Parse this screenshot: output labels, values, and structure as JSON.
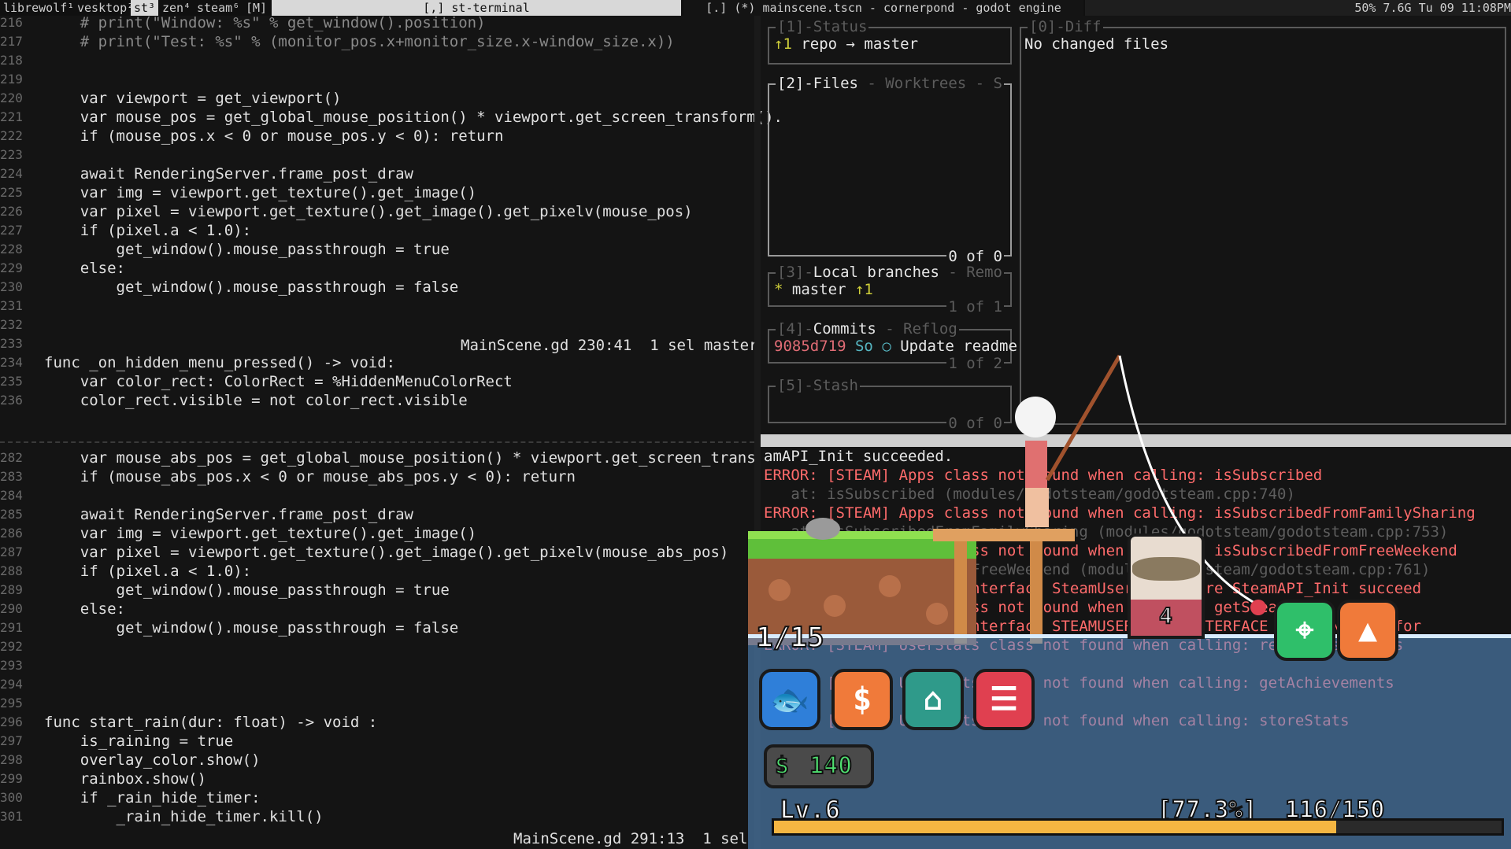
{
  "topbar": {
    "workspaces": [
      "librewolf¹",
      "vesktop²",
      "st³",
      "zen⁴",
      "steam⁶",
      "[M]"
    ],
    "active_workspace": "st³",
    "left_title": "[,] st-terminal",
    "right_title": "[.] (*) mainscene.tscn - cornerpond - godot engine",
    "system": "50% 7.6G Tu 09 11:08PM"
  },
  "editor_top": {
    "lines": [
      {
        "n": "216",
        "t": "    # print(\"Window: %s\" % get_window().position)",
        "c": true
      },
      {
        "n": "217",
        "t": "    # print(\"Test: %s\" % (monitor_pos.x+monitor_size.x-window_size.x))",
        "c": true
      },
      {
        "n": "218",
        "t": ""
      },
      {
        "n": "219",
        "t": ""
      },
      {
        "n": "220",
        "t": "    var viewport = get_viewport()"
      },
      {
        "n": "221",
        "t": "    var mouse_pos = get_global_mouse_position() * viewport.get_screen_transform()."
      },
      {
        "n": "222",
        "t": "    if (mouse_pos.x < 0 or mouse_pos.y < 0): return"
      },
      {
        "n": "223",
        "t": ""
      },
      {
        "n": "224",
        "t": "    await RenderingServer.frame_post_draw"
      },
      {
        "n": "225",
        "t": "    var img = viewport.get_texture().get_image()"
      },
      {
        "n": "226",
        "t": "    var pixel = viewport.get_texture().get_image().get_pixelv(mouse_pos)"
      },
      {
        "n": "227",
        "t": "    if (pixel.a < 1.0):"
      },
      {
        "n": "228",
        "t": "        get_window().mouse_passthrough = true"
      },
      {
        "n": "229",
        "t": "    else:"
      },
      {
        "n": "230",
        "t": "        get_window().mouse_passthrough = false"
      },
      {
        "n": "231",
        "t": ""
      },
      {
        "n": "232",
        "t": ""
      },
      {
        "n": "233",
        "t": ""
      },
      {
        "n": "234",
        "t": "func _on_hidden_menu_pressed() -> void:"
      },
      {
        "n": "235",
        "t": "    var color_rect: ColorRect = %HiddenMenuColorRect"
      },
      {
        "n": "236",
        "t": "    color_rect.visible = not color_rect.visible"
      }
    ],
    "status": "MainScene.gd 230:41  1 sel master"
  },
  "editor_bottom": {
    "lines": [
      {
        "n": "282",
        "t": "    var mouse_abs_pos = get_global_mouse_position() * viewport.get_screen_transfor"
      },
      {
        "n": "283",
        "t": "    if (mouse_abs_pos.x < 0 or mouse_abs_pos.y < 0): return"
      },
      {
        "n": "284",
        "t": ""
      },
      {
        "n": "285",
        "t": "    await RenderingServer.frame_post_draw"
      },
      {
        "n": "286",
        "t": "    var img = viewport.get_texture().get_image()"
      },
      {
        "n": "287",
        "t": "    var pixel = viewport.get_texture().get_image().get_pixelv(mouse_abs_pos)"
      },
      {
        "n": "288",
        "t": "    if (pixel.a < 1.0):"
      },
      {
        "n": "289",
        "t": "        get_window().mouse_passthrough = true"
      },
      {
        "n": "290",
        "t": "    else:"
      },
      {
        "n": "291",
        "t": "        get_window().mouse_passthrough = false"
      },
      {
        "n": "292",
        "t": ""
      },
      {
        "n": "293",
        "t": ""
      },
      {
        "n": "294",
        "t": ""
      },
      {
        "n": "295",
        "t": ""
      },
      {
        "n": "296",
        "t": "func start_rain(dur: float) -> void :"
      },
      {
        "n": "297",
        "t": "    is_raining = true"
      },
      {
        "n": "298",
        "t": "    overlay_color.show()"
      },
      {
        "n": "299",
        "t": "    rainbox.show()"
      },
      {
        "n": "300",
        "t": "    if _rain_hide_timer:"
      },
      {
        "n": "301",
        "t": "        _rain_hide_timer.kill()"
      }
    ],
    "status": "MainScene.gd 291:13  1 sel"
  },
  "git": {
    "status": {
      "title": "[1]-Status",
      "content_arrow": "↑1",
      "content": " repo → master"
    },
    "diff": {
      "title": "[0]-Diff",
      "content": "No changed files"
    },
    "files": {
      "title": "[2]-Files",
      "tabs": " - Worktrees - S",
      "count": "0 of 0"
    },
    "branches": {
      "title_num": "[3]-",
      "title": "Local branches",
      "tabs": " - Remo",
      "item_star": "*",
      "item": " master ",
      "item_ahead": "↑1",
      "count": "1 of 1"
    },
    "commits": {
      "title_num": "[4]-",
      "title": "Commits",
      "tabs": " - Reflog",
      "hash": "9085d719",
      "author": "So",
      "marker": "○",
      "message": " Update readme",
      "count": "1 of 2"
    },
    "stash": {
      "title": "[5]-Stash",
      "count": "0 of 0"
    }
  },
  "console": {
    "lines": [
      {
        "t": "amAPI_Init succeeded.",
        "k": "norm"
      },
      {
        "t": "ERROR: [STEAM] Apps class not found when calling: isSubscribed",
        "k": "err"
      },
      {
        "t": "   at: isSubscribed (modules/godotsteam/godotsteam.cpp:740)",
        "k": "dim"
      },
      {
        "t": "ERROR: [STEAM] Apps class not found when calling: isSubscribedFromFamilySharing",
        "k": "err"
      },
      {
        "t": "   at: isSubscribedFromFamilySharing (modules/godotsteam/godotsteam.cpp:753)",
        "k": "dim"
      },
      {
        "t": "ERROR: [STEAM] Apps class not found when calling: isSubscribedFromFreeWeekend",
        "k": "err"
      },
      {
        "t": "   at: isSubscribedFromFreeWeekend (modules/godotsteam/godotsteam.cpp:761)",
        "k": "dim"
      },
      {
        "t": "ERROR: Accessed Steam interface SteamUser023 before SteamAPI_Init succeed",
        "k": "err"
      },
      {
        "t": "ERROR: [STEAM] User class not found when calling: getSteamID",
        "k": "err"
      },
      {
        "t": "ERROR: Accessed Steam interface STEAMUSERSTATS_INTERFACE_VERSION013 befor",
        "k": "err"
      },
      {
        "t": "ERROR: [STEAM] UserStats class not found when calling: requestUserStats",
        "k": "err"
      },
      {
        "t": "",
        "k": "dim"
      },
      {
        "t": "ERROR: [STEAM] UserStats class not found when calling: getAchievements",
        "k": "err"
      },
      {
        "t": "",
        "k": "dim"
      },
      {
        "t": "ERROR: [STEAM] UserStats class not found when calling: storeStats",
        "k": "err"
      },
      {
        "t": "",
        "k": "dim"
      }
    ]
  },
  "game": {
    "fish_counter": "1/15",
    "money": "140",
    "catch_count": "4",
    "level": "Lv.6",
    "xp_percent_label": "[77.3%]",
    "xp_values": "116/150",
    "xp_fraction": 0.773,
    "colors": {
      "fish_btn": "#2f7fd9",
      "shop_btn": "#f07a3a",
      "tackle_btn": "#2f9a8a",
      "log_btn": "#e04050",
      "map_btn": "#2fbf6a",
      "up_btn": "#f07a3a",
      "xp": "#f5b642"
    }
  }
}
